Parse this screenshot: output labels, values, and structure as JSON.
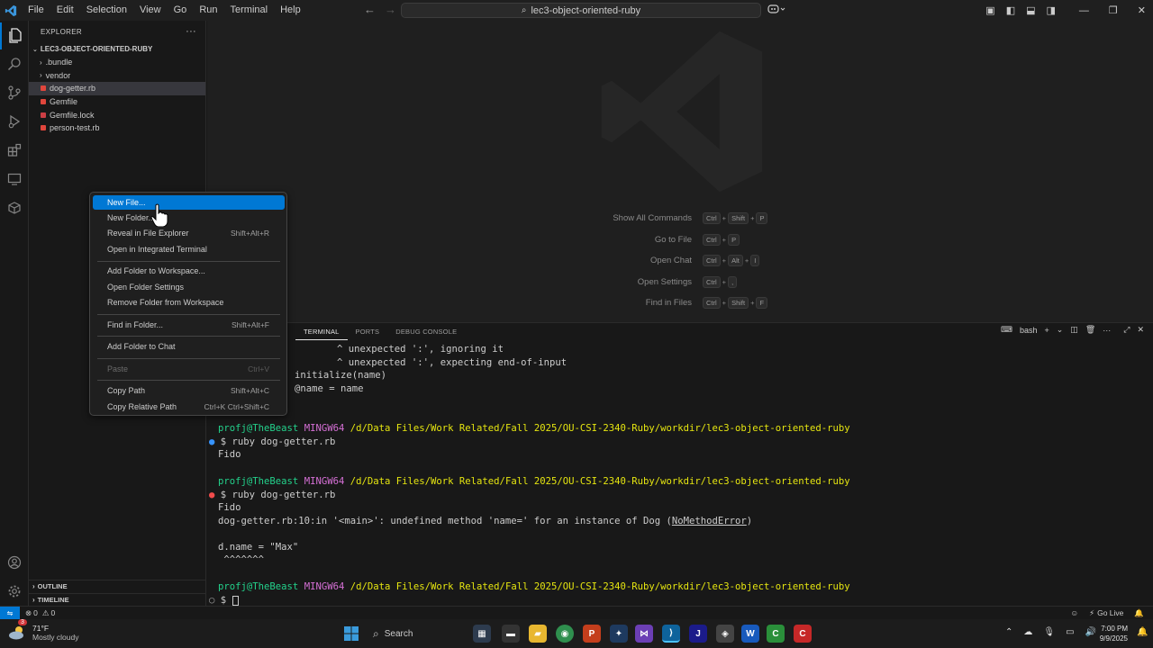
{
  "titlebar": {
    "menu": [
      "File",
      "Edit",
      "Selection",
      "View",
      "Go",
      "Run",
      "Terminal",
      "Help"
    ],
    "search_text": "lec3-object-oriented-ruby"
  },
  "sidebar": {
    "header": "EXPLORER",
    "folder": "LEC3-OBJECT-ORIENTED-RUBY",
    "items": [
      {
        "label": ".bundle",
        "kind": "folder"
      },
      {
        "label": "vendor",
        "kind": "folder"
      },
      {
        "label": "dog-getter.rb",
        "kind": "ruby",
        "selected": true
      },
      {
        "label": "Gemfile",
        "kind": "ruby"
      },
      {
        "label": "Gemfile.lock",
        "kind": "lock"
      },
      {
        "label": "person-test.rb",
        "kind": "ruby"
      }
    ],
    "outline": "OUTLINE",
    "timeline": "TIMELINE"
  },
  "editor": {
    "shortcuts": [
      {
        "label": "Show All Commands",
        "keys": [
          "Ctrl",
          "Shift",
          "P"
        ]
      },
      {
        "label": "Go to File",
        "keys": [
          "Ctrl",
          "P"
        ]
      },
      {
        "label": "Open Chat",
        "keys": [
          "Ctrl",
          "Alt",
          "I"
        ]
      },
      {
        "label": "Open Settings",
        "keys": [
          "Ctrl",
          ","
        ]
      },
      {
        "label": "Find in Files",
        "keys": [
          "Ctrl",
          "Shift",
          "F"
        ]
      }
    ]
  },
  "context_menu": {
    "items": [
      {
        "label": "New File...",
        "accel": "",
        "active": true
      },
      {
        "label": "New Folder...",
        "accel": ""
      },
      {
        "label": "Reveal in File Explorer",
        "accel": "Shift+Alt+R"
      },
      {
        "label": "Open in Integrated Terminal",
        "accel": ""
      },
      {
        "label": "Add Folder to Workspace...",
        "accel": ""
      },
      {
        "label": "Open Folder Settings",
        "accel": ""
      },
      {
        "label": "Remove Folder from Workspace",
        "accel": ""
      },
      {
        "label": "Find in Folder...",
        "accel": "Shift+Alt+F"
      },
      {
        "label": "Add Folder to Chat",
        "accel": ""
      },
      {
        "label": "Paste",
        "accel": "Ctrl+V",
        "disabled": true
      },
      {
        "label": "Copy Path",
        "accel": "Shift+Alt+C"
      },
      {
        "label": "Copy Relative Path",
        "accel": "Ctrl+K Ctrl+Shift+C"
      }
    ]
  },
  "panel": {
    "tabs": [
      "TERMINAL",
      "PORTS",
      "DEBUG CONSOLE"
    ],
    "active_tab": "TERMINAL",
    "shell": "bash"
  },
  "terminal": {
    "line1": "^ unexpected ':', ignoring it",
    "line2": "^ unexpected ':', expecting end-of-input",
    "line3": "initialize(name)",
    "line4": "@name = name",
    "user": "profj@TheBeast",
    "env": "MINGW64",
    "path": "/d/Data Files/Work Related/Fall 2025/OU-CSI-2340-Ruby/workdir/lec3-object-oriented-ruby",
    "cmd1": "$ ruby dog-getter.rb",
    "out1": "Fido",
    "cmd2": "$ ruby dog-getter.rb",
    "out2": "Fido",
    "err_prefix": "dog-getter.rb:10:in '<main>': ",
    "err_msg": "undefined method 'name=' for an instance of Dog (",
    "err_class": "NoMethodError",
    "err_suffix": ")",
    "code_line": "d.name = \"Max\"",
    "carets": " ^^^^^^^",
    "prompt": "$ "
  },
  "statusbar": {
    "errors": "0",
    "warnings": "0",
    "go_live": "Go Live"
  },
  "taskbar": {
    "weather_temp": "71°F",
    "weather_desc": "Mostly cloudy",
    "badge": "3",
    "search": "Search",
    "time": "7:00 PM",
    "date": "9/9/2025"
  },
  "colors": {
    "accent": "#0078d4",
    "prompt_green": "#23d18b",
    "prompt_purple": "#d670d6",
    "path_yellow": "#e5e510",
    "ruby_red": "#e0463c"
  }
}
